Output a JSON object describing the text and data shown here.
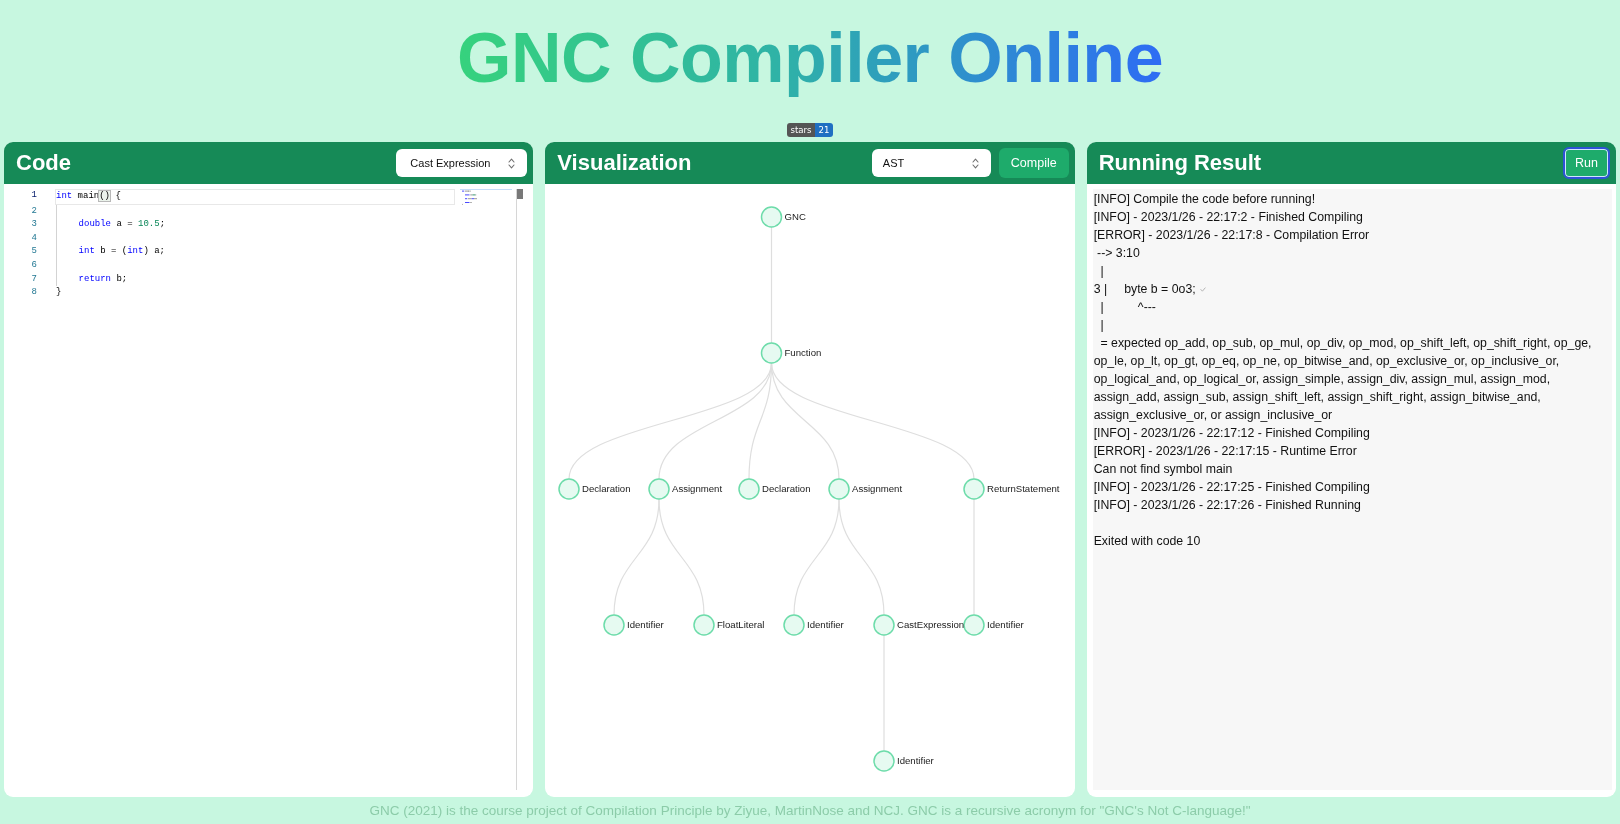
{
  "page": {
    "title": "GNC Compiler Online",
    "stars_badge": {
      "label": "stars",
      "count": "21"
    }
  },
  "code_panel": {
    "title": "Code",
    "example_select": {
      "value": "Cast Expression"
    },
    "lines": [
      {
        "number": "1",
        "current": true,
        "tokens": [
          {
            "text": "int",
            "kind": "keyword"
          },
          {
            "text": " main",
            "kind": "plain"
          },
          {
            "text": "()",
            "kind": "bracket_match"
          },
          {
            "text": " {",
            "kind": "plain"
          }
        ]
      },
      {
        "number": "2",
        "current": false
      },
      {
        "number": "3",
        "current": false,
        "tokens": [
          {
            "text": "    double",
            "kind": "keyword"
          },
          {
            "text": " a = ",
            "kind": "plain"
          },
          {
            "text": "10.5",
            "kind": "number"
          },
          {
            "text": ";",
            "kind": "plain"
          }
        ]
      },
      {
        "number": "4",
        "current": false
      },
      {
        "number": "5",
        "current": false,
        "tokens": [
          {
            "text": "    int",
            "kind": "keyword"
          },
          {
            "text": " b = (",
            "kind": "plain"
          },
          {
            "text": "int",
            "kind": "keyword"
          },
          {
            "text": ") a;",
            "kind": "plain"
          }
        ]
      },
      {
        "number": "6",
        "current": false
      },
      {
        "number": "7",
        "current": false,
        "tokens": [
          {
            "text": "    return",
            "kind": "keyword"
          },
          {
            "text": " b;",
            "kind": "plain"
          }
        ]
      },
      {
        "number": "8",
        "current": false,
        "tokens": [
          {
            "text": "}",
            "kind": "plain"
          }
        ]
      }
    ]
  },
  "visualization_panel": {
    "title": "Visualization",
    "view_select": {
      "value": "AST"
    },
    "compile_button": {
      "label": "Compile",
      "focused": false
    },
    "tree": {
      "label": "GNC",
      "children": [
        {
          "label": "Function",
          "children": [
            {
              "label": "Declaration"
            },
            {
              "label": "Assignment",
              "children": [
                {
                  "label": "Identifier"
                },
                {
                  "label": "FloatLiteral"
                }
              ]
            },
            {
              "label": "Declaration"
            },
            {
              "label": "Assignment",
              "children": [
                {
                  "label": "Identifier"
                },
                {
                  "label": "CastExpression",
                  "children": [
                    {
                      "label": "Identifier"
                    }
                  ]
                }
              ]
            },
            {
              "label": "ReturnStatement",
              "children": [
                {
                  "label": "Identifier"
                }
              ]
            }
          ]
        }
      ]
    }
  },
  "result_panel": {
    "title": "Running Result",
    "run_button": {
      "label": "Run",
      "focused": true
    },
    "log": [
      {
        "text": "[INFO] Compile the code before running!",
        "marked": false
      },
      {
        "text": "[INFO] - 2023/1/26 - 22:17:2 - Finished Compiling",
        "marked": false
      },
      {
        "text": "[ERROR] - 2023/1/26 - 22:17:8 - Compilation Error",
        "marked": false
      },
      {
        "text": " --> 3:10",
        "marked": false
      },
      {
        "text": "  |",
        "marked": false
      },
      {
        "text": "3 |     byte b = 0o3;",
        "marked": true
      },
      {
        "text": "  |          ^---",
        "marked": false
      },
      {
        "text": "  |",
        "marked": false
      },
      {
        "text": "  = expected op_add, op_sub, op_mul, op_div, op_mod, op_shift_left, op_shift_right, op_ge, op_le, op_lt, op_gt, op_eq, op_ne, op_bitwise_and, op_exclusive_or, op_inclusive_or, op_logical_and, op_logical_or, assign_simple, assign_div, assign_mul, assign_mod, assign_add, assign_sub, assign_shift_left, assign_shift_right, assign_bitwise_and, assign_exclusive_or, or assign_inclusive_or",
        "marked": false
      },
      {
        "text": "[INFO] - 2023/1/26 - 22:17:12 - Finished Compiling",
        "marked": false
      },
      {
        "text": "[ERROR] - 2023/1/26 - 22:17:15 - Runtime Error",
        "marked": false
      },
      {
        "text": "Can not find symbol main",
        "marked": false
      },
      {
        "text": "[INFO] - 2023/1/26 - 22:17:25 - Finished Compiling",
        "marked": false
      },
      {
        "text": "[INFO] - 2023/1/26 - 22:17:26 - Finished Running",
        "marked": false
      }
    ],
    "exit_message": "Exited with code 10"
  },
  "footer": "GNC (2021) is the course project of Compilation Principle by Ziyue, MartinNose and NCJ. GNC is a recursive acronym for \"GNC's Not C-language!\""
}
